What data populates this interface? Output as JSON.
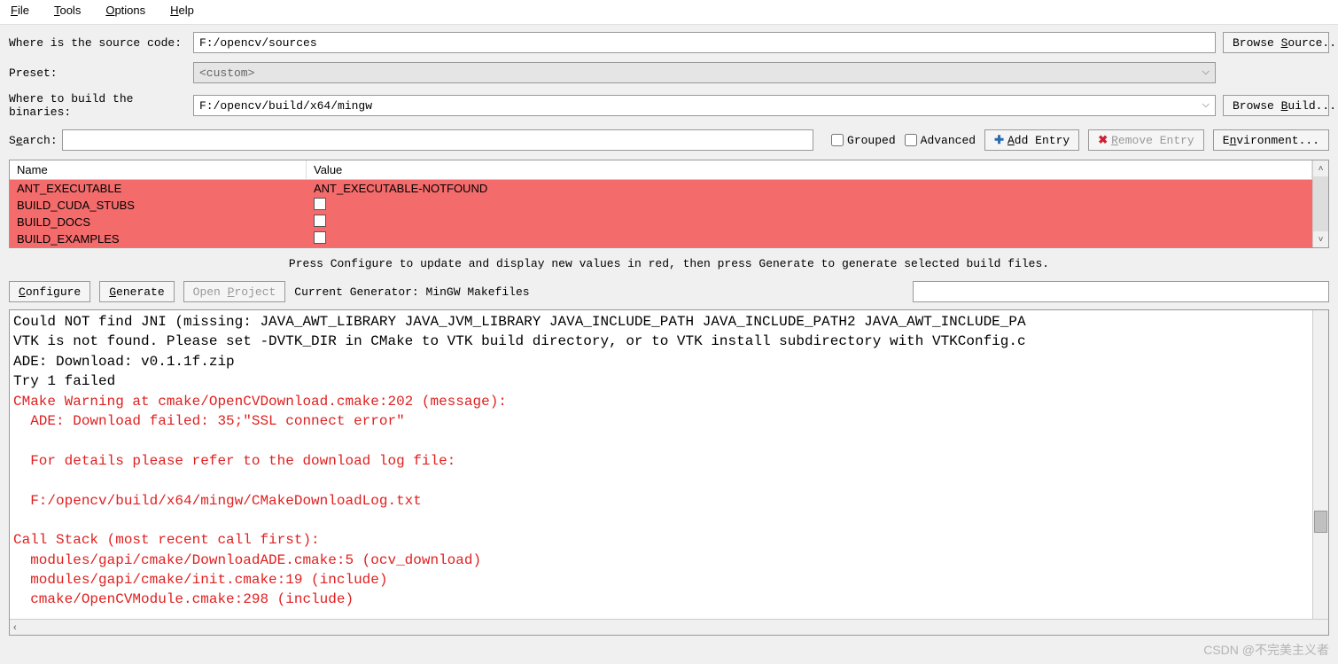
{
  "menu": {
    "file": "File",
    "tools": "Tools",
    "options": "Options",
    "help": "Help"
  },
  "labels": {
    "source": "Where is the source code:",
    "preset": "Preset:",
    "build": "Where to build the binaries:",
    "search": "Search:"
  },
  "inputs": {
    "source_path": "F:/opencv/sources",
    "preset_value": "<custom>",
    "build_path": "F:/opencv/build/x64/mingw",
    "search_value": ""
  },
  "buttons": {
    "browse_source": "Browse Source...",
    "browse_build": "Browse Build...",
    "add_entry": "Add Entry",
    "remove_entry": "Remove Entry",
    "environment": "Environment...",
    "configure": "Configure",
    "generate": "Generate",
    "open_project": "Open Project"
  },
  "checkboxes": {
    "grouped": "Grouped",
    "advanced": "Advanced"
  },
  "table": {
    "header_name": "Name",
    "header_value": "Value",
    "rows": [
      {
        "name": "ANT_EXECUTABLE",
        "value": "ANT_EXECUTABLE-NOTFOUND",
        "is_checkbox": false
      },
      {
        "name": "BUILD_CUDA_STUBS",
        "value": "",
        "is_checkbox": true
      },
      {
        "name": "BUILD_DOCS",
        "value": "",
        "is_checkbox": true
      },
      {
        "name": "BUILD_EXAMPLES",
        "value": "",
        "is_checkbox": true
      }
    ]
  },
  "hint_text": "Press Configure to update and display new values in red, then press Generate to generate selected build files.",
  "generator_label": "Current Generator: MinGW Makefiles",
  "output_lines": [
    {
      "text": "Could NOT find JNI (missing: JAVA_AWT_LIBRARY JAVA_JVM_LIBRARY JAVA_INCLUDE_PATH JAVA_INCLUDE_PATH2 JAVA_AWT_INCLUDE_PA",
      "red": false
    },
    {
      "text": "VTK is not found. Please set -DVTK_DIR in CMake to VTK build directory, or to VTK install subdirectory with VTKConfig.c",
      "red": false
    },
    {
      "text": "ADE: Download: v0.1.1f.zip",
      "red": false
    },
    {
      "text": "Try 1 failed",
      "red": false
    },
    {
      "text": "CMake Warning at cmake/OpenCVDownload.cmake:202 (message):",
      "red": true
    },
    {
      "text": "  ADE: Download failed: 35;\"SSL connect error\"",
      "red": true
    },
    {
      "text": "",
      "red": true
    },
    {
      "text": "  For details please refer to the download log file:",
      "red": true
    },
    {
      "text": "",
      "red": true
    },
    {
      "text": "  F:/opencv/build/x64/mingw/CMakeDownloadLog.txt",
      "red": true
    },
    {
      "text": "",
      "red": true
    },
    {
      "text": "Call Stack (most recent call first):",
      "red": true
    },
    {
      "text": "  modules/gapi/cmake/DownloadADE.cmake:5 (ocv_download)",
      "red": true
    },
    {
      "text": "  modules/gapi/cmake/init.cmake:19 (include)",
      "red": true
    },
    {
      "text": "  cmake/OpenCVModule.cmake:298 (include)",
      "red": true
    }
  ],
  "watermark": "CSDN @不完美主义者"
}
